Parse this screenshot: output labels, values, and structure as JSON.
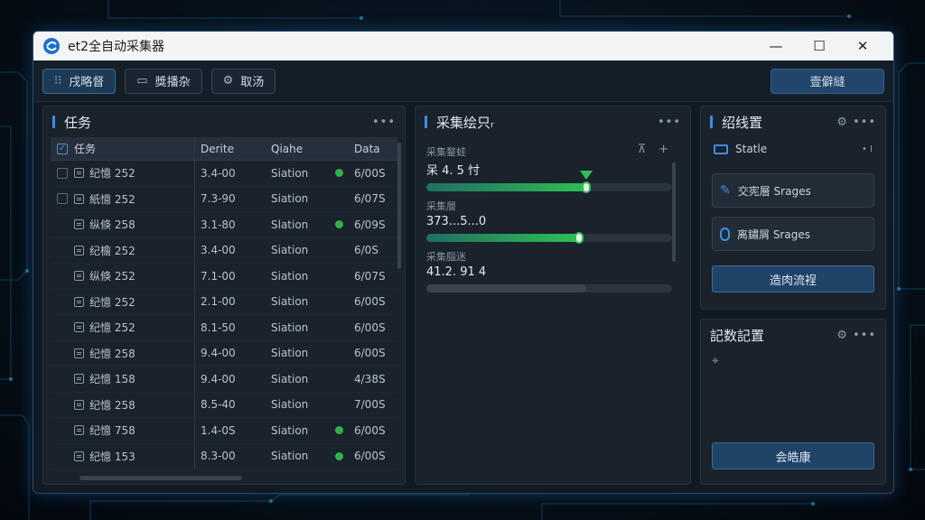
{
  "window": {
    "title": "et2全自动采集器",
    "minimize": "—",
    "maximize": "☐",
    "close": "✕"
  },
  "toolbar": {
    "buttons": [
      {
        "label": "戌略督",
        "icon": "⁝⁝"
      },
      {
        "label": "獎播杂",
        "icon": "▭"
      },
      {
        "label": "取汤",
        "icon": "⚙"
      }
    ],
    "primary_label": "壹僻縫"
  },
  "tasks": {
    "title": "任务",
    "menu": "•••",
    "columns": [
      "任务",
      "Derite",
      "Qiahe",
      "Data"
    ],
    "rows": [
      {
        "name": "纪憶 252",
        "d": "3.4-00",
        "status": "Siation",
        "dot": true,
        "data": "6/00S",
        "checkbox": true
      },
      {
        "name": "紙憶 252",
        "d": "7.3-90",
        "status": "Siation",
        "dot": false,
        "data": "6/07S",
        "checkbox": true
      },
      {
        "name": "纵倏 258",
        "d": "3.1-80",
        "status": "Slation",
        "dot": true,
        "data": "6/09S",
        "checkbox": false
      },
      {
        "name": "纪檐 252",
        "d": "3.4-00",
        "status": "Siation",
        "dot": false,
        "data": "6/0S",
        "checkbox": false
      },
      {
        "name": "纵倏 252",
        "d": "7.1-00",
        "status": "Siation",
        "dot": false,
        "data": "6/07S",
        "checkbox": false
      },
      {
        "name": "纪憶 252",
        "d": "2.1-00",
        "status": "Siation",
        "dot": false,
        "data": "6/00S",
        "checkbox": false
      },
      {
        "name": "纪憶 252",
        "d": "8.1-50",
        "status": "Siation",
        "dot": false,
        "data": "6/00S",
        "checkbox": false
      },
      {
        "name": "纪憶 258",
        "d": "9.4-00",
        "status": "Siation",
        "dot": false,
        "data": "6/00S",
        "checkbox": false
      },
      {
        "name": "纪憶 158",
        "d": "9.4-00",
        "status": "Siation",
        "dot": false,
        "data": "4/38S",
        "checkbox": false
      },
      {
        "name": "纪憶 258",
        "d": "8.5-40",
        "status": "Siation",
        "dot": false,
        "data": "7/00S",
        "checkbox": false
      },
      {
        "name": "纪憶 758",
        "d": "1.4-0S",
        "status": "Siation",
        "dot": true,
        "data": "6/00S",
        "checkbox": false
      },
      {
        "name": "纪憶 153",
        "d": "8.3-00",
        "status": "Siation",
        "dot": true,
        "data": "6/00S",
        "checkbox": false
      }
    ]
  },
  "progress": {
    "title": "采集绘只ᵣ",
    "menu": "•••",
    "top_icons": [
      "⊼",
      "+"
    ],
    "items": [
      {
        "label": "采集鍪蛙",
        "value": "呆 4. 5 忖",
        "fraction": 0.65,
        "knob": true,
        "marker": true
      },
      {
        "label": "采集層",
        "value": "373...5...0",
        "fraction": 0.62,
        "knob": true,
        "marker": false
      },
      {
        "label": "采集腦迷",
        "value": "41.2. 91 4",
        "fraction": 0.65,
        "knob": false,
        "marker": false
      }
    ]
  },
  "settings": {
    "title": "绍线置",
    "menu": "⚙ •••",
    "state_label": "Statle",
    "state_suffix": "• I",
    "btn1": "交宪層 Srages",
    "btn2": "离鏽屑 Srages",
    "action": "造肉流裎"
  },
  "config": {
    "title": "記数記置",
    "menu": "⚙ •••",
    "small_icon": "⌖",
    "action": "会皓康"
  },
  "colors": {
    "accent": "#3d8ee0",
    "progress": "#2fbf55",
    "dot": "#2fb34a"
  }
}
